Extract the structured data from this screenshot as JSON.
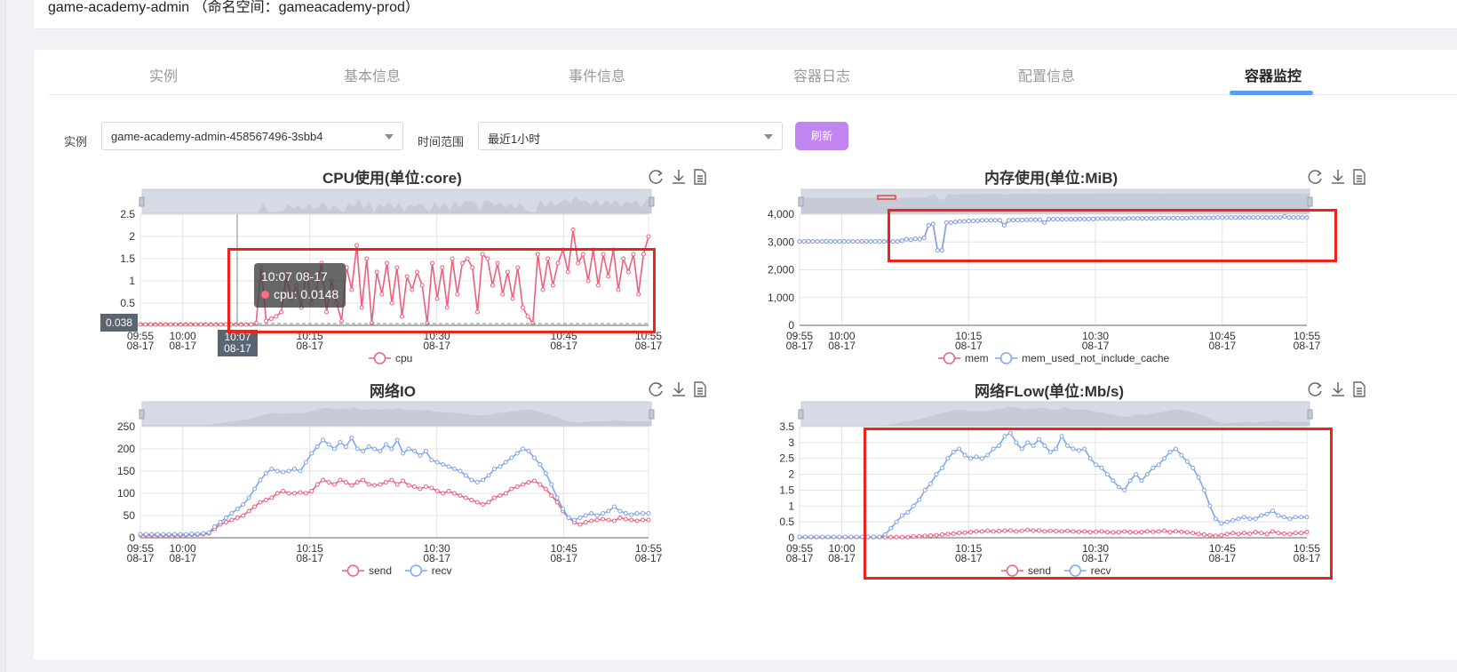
{
  "header": {
    "title": "game-academy-admin （命名空间：gameacademy-prod）"
  },
  "tabs": [
    {
      "label": "实例",
      "active": false
    },
    {
      "label": "基本信息",
      "active": false
    },
    {
      "label": "事件信息",
      "active": false
    },
    {
      "label": "容器日志",
      "active": false
    },
    {
      "label": "配置信息",
      "active": false
    },
    {
      "label": "容器监控",
      "active": true
    }
  ],
  "filters": {
    "instance_label": "实例",
    "instance_value": "game-academy-admin-458567496-3sbb4",
    "time_label": "时间范围",
    "time_value": "最近1小时",
    "refresh_label": "刷新"
  },
  "colors": {
    "red": "#ee5f7a",
    "blue": "#7ea6ec",
    "accent": "#c185ef",
    "tab_ink": "#5b9cf5",
    "highlight": "#f0221c"
  },
  "toolbox_icons": [
    "refresh-icon",
    "download-icon",
    "data-view-icon"
  ],
  "tooltip": {
    "time": "10:07 08-17",
    "series": "cpu",
    "value": "0.0148",
    "axis_label": "0.038",
    "x_label": "10:07\n08-17"
  },
  "chart_data": [
    {
      "id": "cpu",
      "type": "line",
      "title": "CPU使用(单位:core)",
      "x_ticks": [
        "09:55\n08-17",
        "10:00\n08-17",
        "10:15\n08-17",
        "10:30\n08-17",
        "10:45\n08-17",
        "10:55\n08-17"
      ],
      "y_ticks": [
        "0",
        "0.5",
        "1",
        "1.5",
        "2",
        "2.5"
      ],
      "ylim": [
        0,
        2.5
      ],
      "legend": [
        "cpu"
      ],
      "series": [
        {
          "name": "cpu",
          "color": "#ee5f7a",
          "values": [
            0.02,
            0.02,
            0.02,
            0.02,
            0.02,
            0.02,
            0.02,
            0.02,
            0.02,
            0.02,
            0.02,
            0.02,
            0.02,
            0.02,
            0.02,
            0.02,
            0.02,
            0.02,
            0.02,
            0.02,
            0.02,
            0.02,
            0.02,
            0.05,
            1.3,
            0.1,
            0.15,
            0.2,
            0.3,
            1.1,
            0.6,
            0.9,
            0.4,
            1.2,
            0.5,
            0.8,
            1.4,
            0.3,
            1.0,
            0.5,
            0.1,
            1.3,
            0.8,
            1.8,
            0.4,
            1.5,
            0.05,
            1.2,
            0.7,
            1.4,
            0.5,
            1.3,
            0.2,
            1.1,
            0.8,
            1.2,
            0.9,
            0.05,
            1.4,
            0.6,
            1.3,
            0.4,
            1.5,
            0.7,
            1.4,
            1.5,
            1.3,
            0.3,
            1.6,
            1.5,
            0.9,
            1.4,
            0.7,
            1.2,
            0.6,
            1.3,
            0.4,
            0.2,
            0.05,
            1.6,
            0.8,
            1.5,
            0.9,
            1.4,
            1.7,
            1.2,
            2.15,
            1.4,
            1.6,
            1.0,
            1.7,
            0.9,
            1.6,
            1.1,
            1.7,
            0.8,
            1.5,
            1.2,
            1.6,
            0.7,
            1.6,
            2.0
          ]
        }
      ]
    },
    {
      "id": "mem",
      "type": "line",
      "title": "内存使用(单位:MiB)",
      "x_ticks": [
        "09:55\n08-17",
        "10:00\n08-17",
        "10:15\n08-17",
        "10:30\n08-17",
        "10:45\n08-17",
        "10:55\n08-17"
      ],
      "y_ticks": [
        "0",
        "1,000",
        "2,000",
        "3,000",
        "4,000"
      ],
      "ylim": [
        0,
        4000
      ],
      "legend": [
        "mem",
        "mem_used_not_include_cache"
      ],
      "series": [
        {
          "name": "mem",
          "color": "#ee5f7a",
          "values": [
            3020,
            3020,
            3020,
            3020,
            3020,
            3020,
            3020,
            3020,
            3020,
            3020,
            3020,
            3020,
            3020,
            3020,
            3020,
            3020,
            3020,
            3020,
            3020,
            3020,
            3020,
            3020,
            3020,
            3050,
            3100,
            3080,
            3120,
            3100,
            3150,
            3600,
            3650,
            2700,
            2700,
            3700,
            3700,
            3720,
            3740,
            3740,
            3760,
            3760,
            3760,
            3780,
            3780,
            3780,
            3780,
            3780,
            3600,
            3780,
            3790,
            3790,
            3790,
            3800,
            3800,
            3800,
            3800,
            3700,
            3820,
            3820,
            3820,
            3820,
            3820,
            3820,
            3820,
            3830,
            3830,
            3830,
            3830,
            3840,
            3840,
            3840,
            3840,
            3840,
            3840,
            3840,
            3850,
            3850,
            3850,
            3850,
            3850,
            3850,
            3850,
            3860,
            3860,
            3860,
            3860,
            3860,
            3860,
            3860,
            3870,
            3870,
            3870,
            3870,
            3870,
            3870,
            3880,
            3880,
            3880,
            3880,
            3880,
            3880,
            3880,
            3880,
            3880,
            3880,
            3880,
            3880,
            3880,
            3880,
            3880,
            3920,
            3880,
            3880,
            3880,
            3880,
            3880
          ]
        },
        {
          "name": "mem_used_not_include_cache",
          "color": "#7ea6ec",
          "values": [
            3020,
            3020,
            3020,
            3020,
            3020,
            3020,
            3020,
            3020,
            3020,
            3020,
            3020,
            3020,
            3020,
            3020,
            3020,
            3020,
            3020,
            3020,
            3020,
            3020,
            3020,
            3020,
            3020,
            3050,
            3100,
            3080,
            3120,
            3100,
            3150,
            3600,
            3650,
            2700,
            2700,
            3700,
            3700,
            3720,
            3740,
            3740,
            3760,
            3760,
            3760,
            3780,
            3780,
            3780,
            3780,
            3780,
            3600,
            3780,
            3790,
            3790,
            3790,
            3800,
            3800,
            3800,
            3800,
            3700,
            3820,
            3820,
            3820,
            3820,
            3820,
            3820,
            3820,
            3830,
            3830,
            3830,
            3830,
            3840,
            3840,
            3840,
            3840,
            3840,
            3840,
            3840,
            3850,
            3850,
            3850,
            3850,
            3850,
            3850,
            3850,
            3860,
            3860,
            3860,
            3860,
            3860,
            3860,
            3860,
            3870,
            3870,
            3870,
            3870,
            3870,
            3870,
            3880,
            3880,
            3880,
            3880,
            3880,
            3880,
            3880,
            3880,
            3880,
            3880,
            3880,
            3880,
            3880,
            3880,
            3880,
            3920,
            3880,
            3880,
            3880,
            3880,
            3880
          ]
        }
      ]
    },
    {
      "id": "netio",
      "type": "line",
      "title": "网络IO",
      "x_ticks": [
        "09:55\n08-17",
        "10:00\n08-17",
        "10:15\n08-17",
        "10:30\n08-17",
        "10:45\n08-17",
        "10:55\n08-17"
      ],
      "y_ticks": [
        "0",
        "50",
        "100",
        "150",
        "200",
        "250"
      ],
      "ylim": [
        0,
        250
      ],
      "legend": [
        "send",
        "recv"
      ],
      "series": [
        {
          "name": "send",
          "color": "#ee5f7a",
          "values": [
            6,
            6,
            6,
            6,
            6,
            6,
            6,
            6,
            6,
            7,
            7,
            8,
            10,
            20,
            30,
            35,
            40,
            45,
            50,
            60,
            70,
            80,
            85,
            90,
            100,
            105,
            100,
            100,
            102,
            100,
            105,
            120,
            130,
            125,
            120,
            130,
            125,
            118,
            125,
            130,
            120,
            118,
            120,
            125,
            130,
            120,
            128,
            118,
            115,
            110,
            115,
            112,
            105,
            100,
            105,
            100,
            95,
            90,
            85,
            80,
            75,
            80,
            90,
            95,
            100,
            110,
            115,
            120,
            125,
            128,
            120,
            110,
            95,
            80,
            60,
            45,
            35,
            30,
            35,
            38,
            40,
            42,
            40,
            38,
            45,
            42,
            40,
            38,
            40,
            40
          ]
        },
        {
          "name": "recv",
          "color": "#7ea6ec",
          "values": [
            8,
            8,
            8,
            8,
            8,
            8,
            8,
            8,
            8,
            9,
            9,
            10,
            12,
            25,
            35,
            45,
            55,
            65,
            75,
            90,
            110,
            130,
            145,
            155,
            150,
            148,
            150,
            155,
            150,
            170,
            190,
            205,
            220,
            210,
            200,
            215,
            205,
            225,
            200,
            195,
            205,
            200,
            195,
            210,
            200,
            220,
            190,
            200,
            195,
            185,
            195,
            175,
            170,
            165,
            160,
            155,
            150,
            140,
            130,
            125,
            130,
            140,
            155,
            160,
            170,
            180,
            190,
            200,
            195,
            180,
            165,
            145,
            120,
            90,
            65,
            45,
            40,
            45,
            50,
            55,
            50,
            55,
            60,
            70,
            60,
            55,
            52,
            55,
            55,
            55
          ]
        }
      ]
    },
    {
      "id": "netflow",
      "type": "line",
      "title": "网络FLow(单位:Mb/s)",
      "x_ticks": [
        "09:55\n08-17",
        "10:00\n08-17",
        "10:15\n08-17",
        "10:30\n08-17",
        "10:45\n08-17",
        "10:55\n08-17"
      ],
      "y_ticks": [
        "0",
        "0.5",
        "1",
        "1.5",
        "2",
        "2.5",
        "3",
        "3.5"
      ],
      "ylim": [
        0,
        3.5
      ],
      "legend": [
        "send",
        "recv"
      ],
      "series": [
        {
          "name": "send",
          "color": "#ee5f7a",
          "values": [
            0.02,
            0.02,
            0.02,
            0.02,
            0.02,
            0.02,
            0.02,
            0.02,
            0.02,
            0.02,
            0.02,
            0.02,
            0.02,
            0.02,
            0.02,
            0.02,
            0.02,
            0.02,
            0.02,
            0.02,
            0.04,
            0.05,
            0.06,
            0.07,
            0.08,
            0.1,
            0.12,
            0.13,
            0.15,
            0.16,
            0.18,
            0.2,
            0.2,
            0.22,
            0.2,
            0.21,
            0.22,
            0.23,
            0.2,
            0.22,
            0.25,
            0.22,
            0.23,
            0.2,
            0.22,
            0.21,
            0.2,
            0.22,
            0.2,
            0.19,
            0.2,
            0.18,
            0.19,
            0.2,
            0.18,
            0.17,
            0.18,
            0.2,
            0.18,
            0.17,
            0.18,
            0.2,
            0.19,
            0.2,
            0.22,
            0.18,
            0.2,
            0.19,
            0.17,
            0.15,
            0.12,
            0.1,
            0.08,
            0.06,
            0.08,
            0.12,
            0.15,
            0.12,
            0.15,
            0.13,
            0.18,
            0.15,
            0.12,
            0.2,
            0.15,
            0.13,
            0.12,
            0.15,
            0.15,
            0.18
          ]
        },
        {
          "name": "recv",
          "color": "#7ea6ec",
          "values": [
            0.03,
            0.03,
            0.03,
            0.03,
            0.03,
            0.03,
            0.03,
            0.03,
            0.03,
            0.03,
            0.03,
            0.03,
            0.03,
            0.03,
            0.03,
            0.1,
            0.3,
            0.5,
            0.7,
            0.8,
            1.0,
            1.2,
            1.5,
            1.7,
            2.0,
            2.2,
            2.5,
            2.7,
            2.8,
            2.6,
            2.5,
            2.55,
            2.5,
            2.6,
            2.8,
            2.9,
            3.2,
            3.3,
            3.0,
            2.8,
            3.0,
            2.9,
            3.1,
            2.9,
            2.7,
            2.8,
            3.2,
            2.9,
            2.8,
            2.75,
            2.8,
            2.5,
            2.3,
            2.2,
            2.0,
            1.8,
            1.6,
            1.5,
            1.8,
            2.0,
            1.8,
            2.0,
            2.2,
            2.3,
            2.5,
            2.7,
            2.8,
            2.6,
            2.4,
            2.2,
            1.9,
            1.5,
            1.0,
            0.6,
            0.45,
            0.5,
            0.55,
            0.6,
            0.65,
            0.6,
            0.6,
            0.7,
            0.75,
            0.85,
            0.7,
            0.65,
            0.6,
            0.65,
            0.65,
            0.65
          ]
        }
      ]
    }
  ]
}
